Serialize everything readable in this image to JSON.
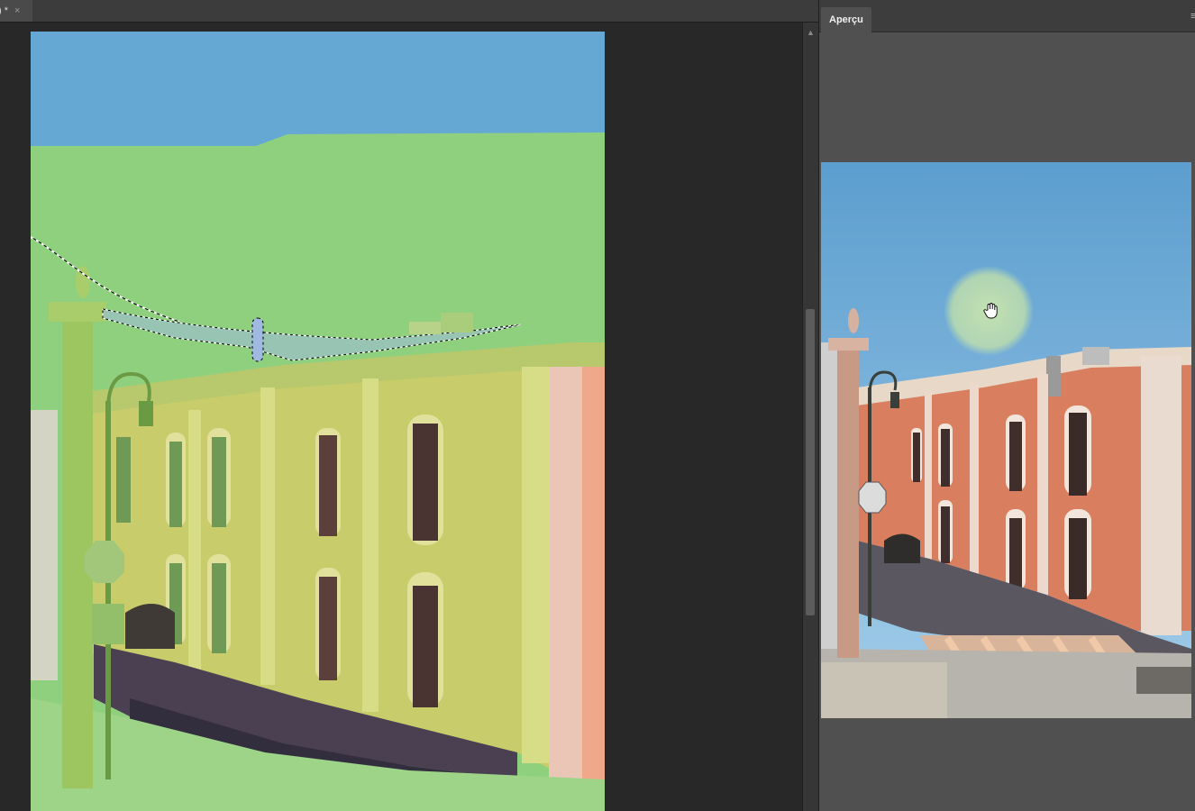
{
  "document": {
    "tab_title": ") *",
    "close_glyph": "×"
  },
  "preview_panel": {
    "tab_label": "Aperçu",
    "menu_glyph": "≡"
  },
  "colors": {
    "mask_green": "#8fd07f",
    "sky_blue": "#66a8d4",
    "building_orange": "#d97e5f",
    "panel_bg": "#505050",
    "canvas_bg": "#282828"
  },
  "icons": {
    "tab_close": "close-icon",
    "panel_menu": "menu-icon",
    "cursor": "hand-cursor-icon"
  }
}
